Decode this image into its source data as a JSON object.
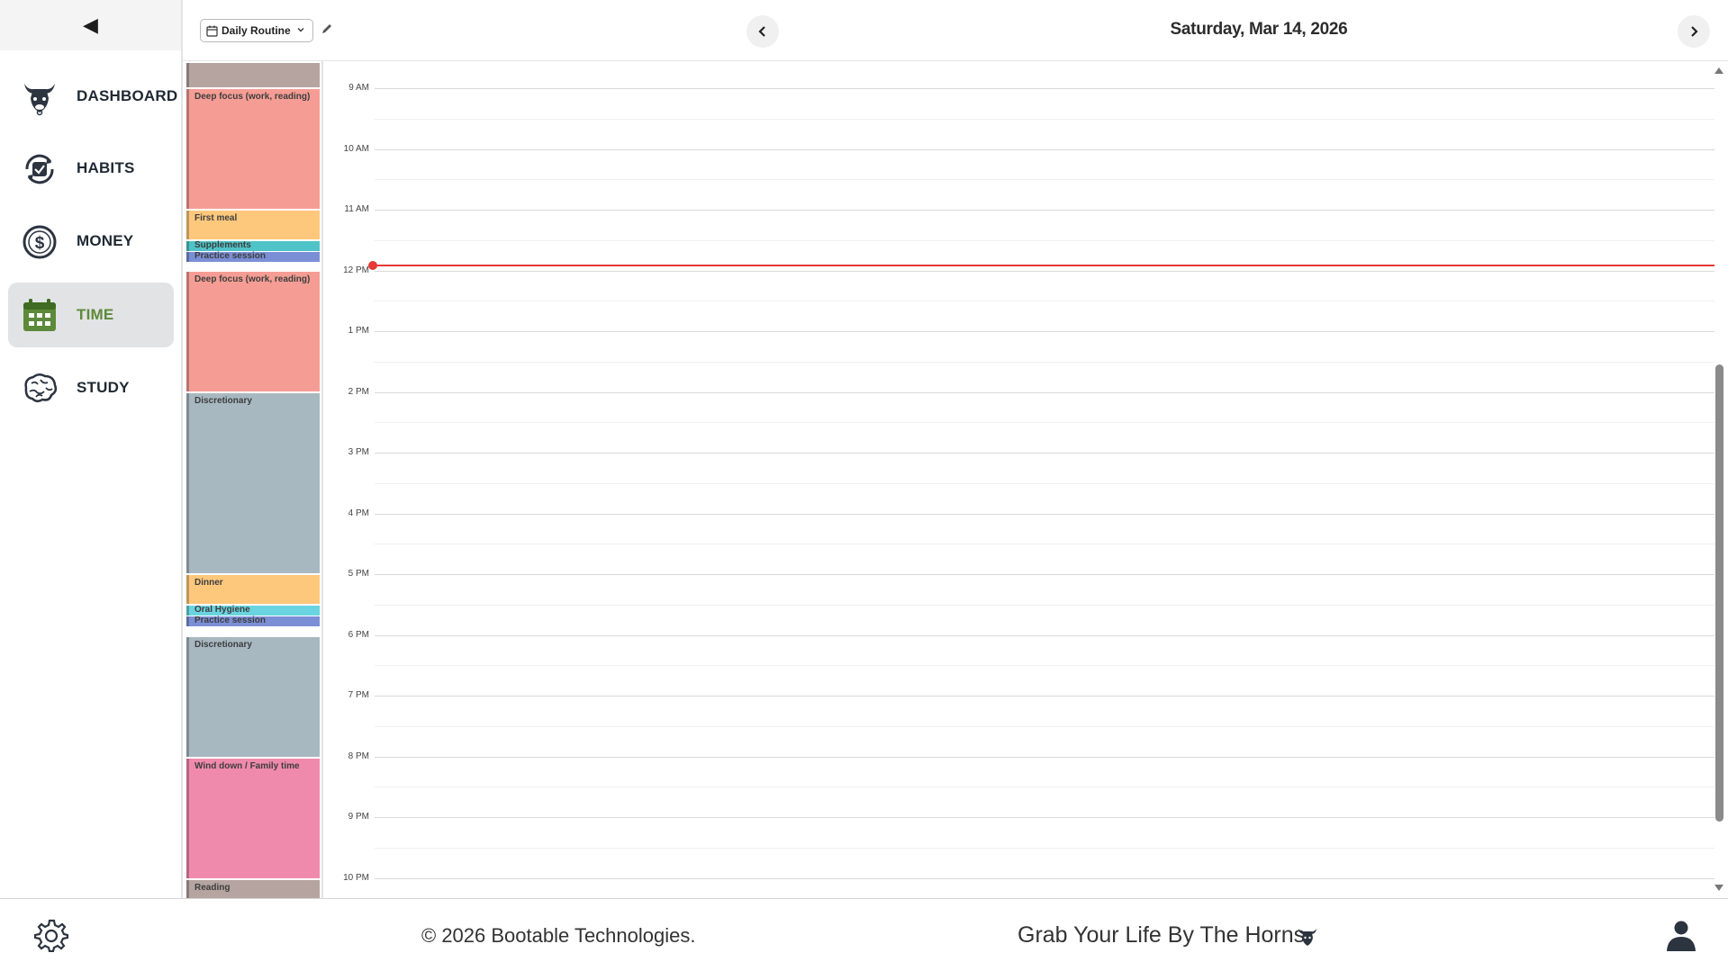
{
  "sidebar": {
    "collapse_glyph": "◀",
    "items": [
      {
        "label": "DASHBOARD",
        "icon": "bull-icon"
      },
      {
        "label": "HABITS",
        "icon": "habit-check-icon"
      },
      {
        "label": "MONEY",
        "icon": "dollar-icon"
      },
      {
        "label": "TIME",
        "icon": "calendar-icon",
        "active": true
      },
      {
        "label": "STUDY",
        "icon": "brain-icon"
      }
    ]
  },
  "topbar": {
    "routine": "Daily Routine",
    "date": "Saturday, Mar 14, 2026"
  },
  "calendar": {
    "hours": [
      "9 AM",
      "10 AM",
      "11 AM",
      "12 PM",
      "1 PM",
      "2 PM",
      "3 PM",
      "4 PM",
      "5 PM",
      "6 PM",
      "7 PM",
      "8 PM",
      "9 PM",
      "10 PM"
    ],
    "current_time_color": "#e53935",
    "blocks": [
      {
        "label": "",
        "color": "#b5a49f"
      },
      {
        "label": "Deep focus (work, reading)",
        "color": "#f59d94"
      },
      {
        "label": "First meal",
        "color": "#fec87c"
      },
      {
        "label": "Supplements",
        "color": "#4fc3c7"
      },
      {
        "label": "Practice session",
        "color": "#7b8fd6"
      },
      {
        "label": "Deep focus (work, reading)",
        "color": "#f59d94"
      },
      {
        "label": "Discretionary",
        "color": "#a8b8c0"
      },
      {
        "label": "Dinner",
        "color": "#fec87c"
      },
      {
        "label": "Oral Hygiene",
        "color": "#6ad4e0"
      },
      {
        "label": "Practice session",
        "color": "#7b8fd6"
      },
      {
        "label": "Discretionary",
        "color": "#a8b8c0"
      },
      {
        "label": "Wind down / Family time",
        "color": "#f08aad"
      },
      {
        "label": "Reading",
        "color": "#b5a49f"
      }
    ]
  },
  "footer": {
    "copyright": "© 2026 Bootable Technologies.",
    "tagline": "Grab Your Life By The Horns."
  }
}
